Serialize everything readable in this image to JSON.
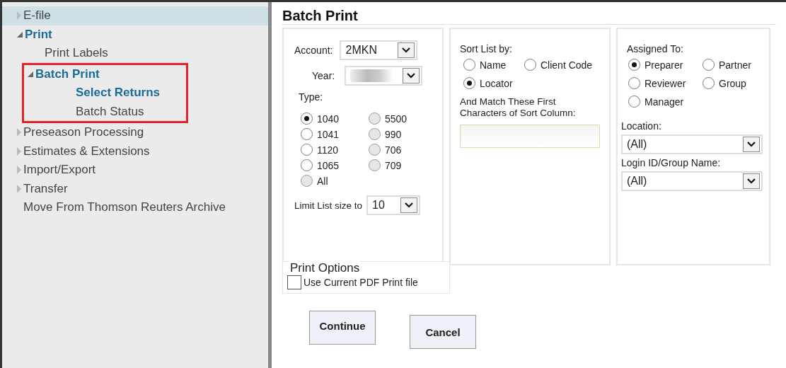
{
  "sidebar": {
    "items": [
      {
        "label": "E-file",
        "kind": "branch",
        "expanded": false,
        "highlighted": true
      },
      {
        "label": "Print",
        "kind": "branch",
        "expanded": true,
        "highlighted": false,
        "children": [
          {
            "label": "Print Labels",
            "kind": "leaf",
            "highlighted": false,
            "selected": false
          },
          {
            "label": "Batch Print",
            "kind": "branch",
            "expanded": true,
            "highlighted": false,
            "annotated": true,
            "children": [
              {
                "label": "Select Returns",
                "kind": "leaf",
                "highlighted": false,
                "selected": true
              },
              {
                "label": "Batch Status",
                "kind": "leaf",
                "highlighted": false,
                "selected": false
              }
            ]
          }
        ]
      },
      {
        "label": "Preseason Processing",
        "kind": "branch",
        "expanded": false,
        "highlighted": false
      },
      {
        "label": "Estimates & Extensions",
        "kind": "branch",
        "expanded": false,
        "highlighted": false
      },
      {
        "label": "Import/Export",
        "kind": "branch",
        "expanded": false,
        "highlighted": false
      },
      {
        "label": "Transfer",
        "kind": "branch",
        "expanded": false,
        "highlighted": false
      },
      {
        "label": "Move From Thomson Reuters Archive",
        "kind": "leaf",
        "highlighted": false,
        "selected": false
      }
    ]
  },
  "form": {
    "title": "Batch Print",
    "account": {
      "label": "Account:",
      "value": "2MKN"
    },
    "year": {
      "label": "Year:"
    },
    "type": {
      "label": "Type:",
      "options": [
        {
          "label": "1040",
          "selected": true,
          "disabled": false
        },
        {
          "label": "5500",
          "selected": false,
          "disabled": true
        },
        {
          "label": "1041",
          "selected": false,
          "disabled": false
        },
        {
          "label": "990",
          "selected": false,
          "disabled": true
        },
        {
          "label": "1120",
          "selected": false,
          "disabled": false
        },
        {
          "label": "706",
          "selected": false,
          "disabled": true
        },
        {
          "label": "1065",
          "selected": false,
          "disabled": false
        },
        {
          "label": "709",
          "selected": false,
          "disabled": true
        },
        {
          "label": "All",
          "selected": false,
          "disabled": true
        }
      ]
    },
    "limit": {
      "label": "Limit List size to",
      "value": "10"
    },
    "sort": {
      "label": "Sort List by:",
      "options": [
        {
          "label": "Name",
          "selected": false
        },
        {
          "label": "Client Code",
          "selected": false
        },
        {
          "label": "Locator",
          "selected": true
        }
      ]
    },
    "match": {
      "label": "And Match These First Characters of Sort Column:"
    },
    "assigned": {
      "label": "Assigned To:",
      "options": [
        {
          "label": "Preparer",
          "selected": true
        },
        {
          "label": "Partner",
          "selected": false
        },
        {
          "label": "Reviewer",
          "selected": false
        },
        {
          "label": "Group",
          "selected": false
        },
        {
          "label": "Manager",
          "selected": false
        }
      ]
    },
    "location": {
      "label": "Location:",
      "value": "(All)"
    },
    "login": {
      "label": "Login ID/Group Name:",
      "value": "(All)"
    },
    "print_options": {
      "title": "Print Options",
      "checkbox": {
        "label": "Use Current PDF Print file",
        "checked": false
      }
    },
    "buttons": [
      "Continue",
      "Cancel"
    ]
  }
}
